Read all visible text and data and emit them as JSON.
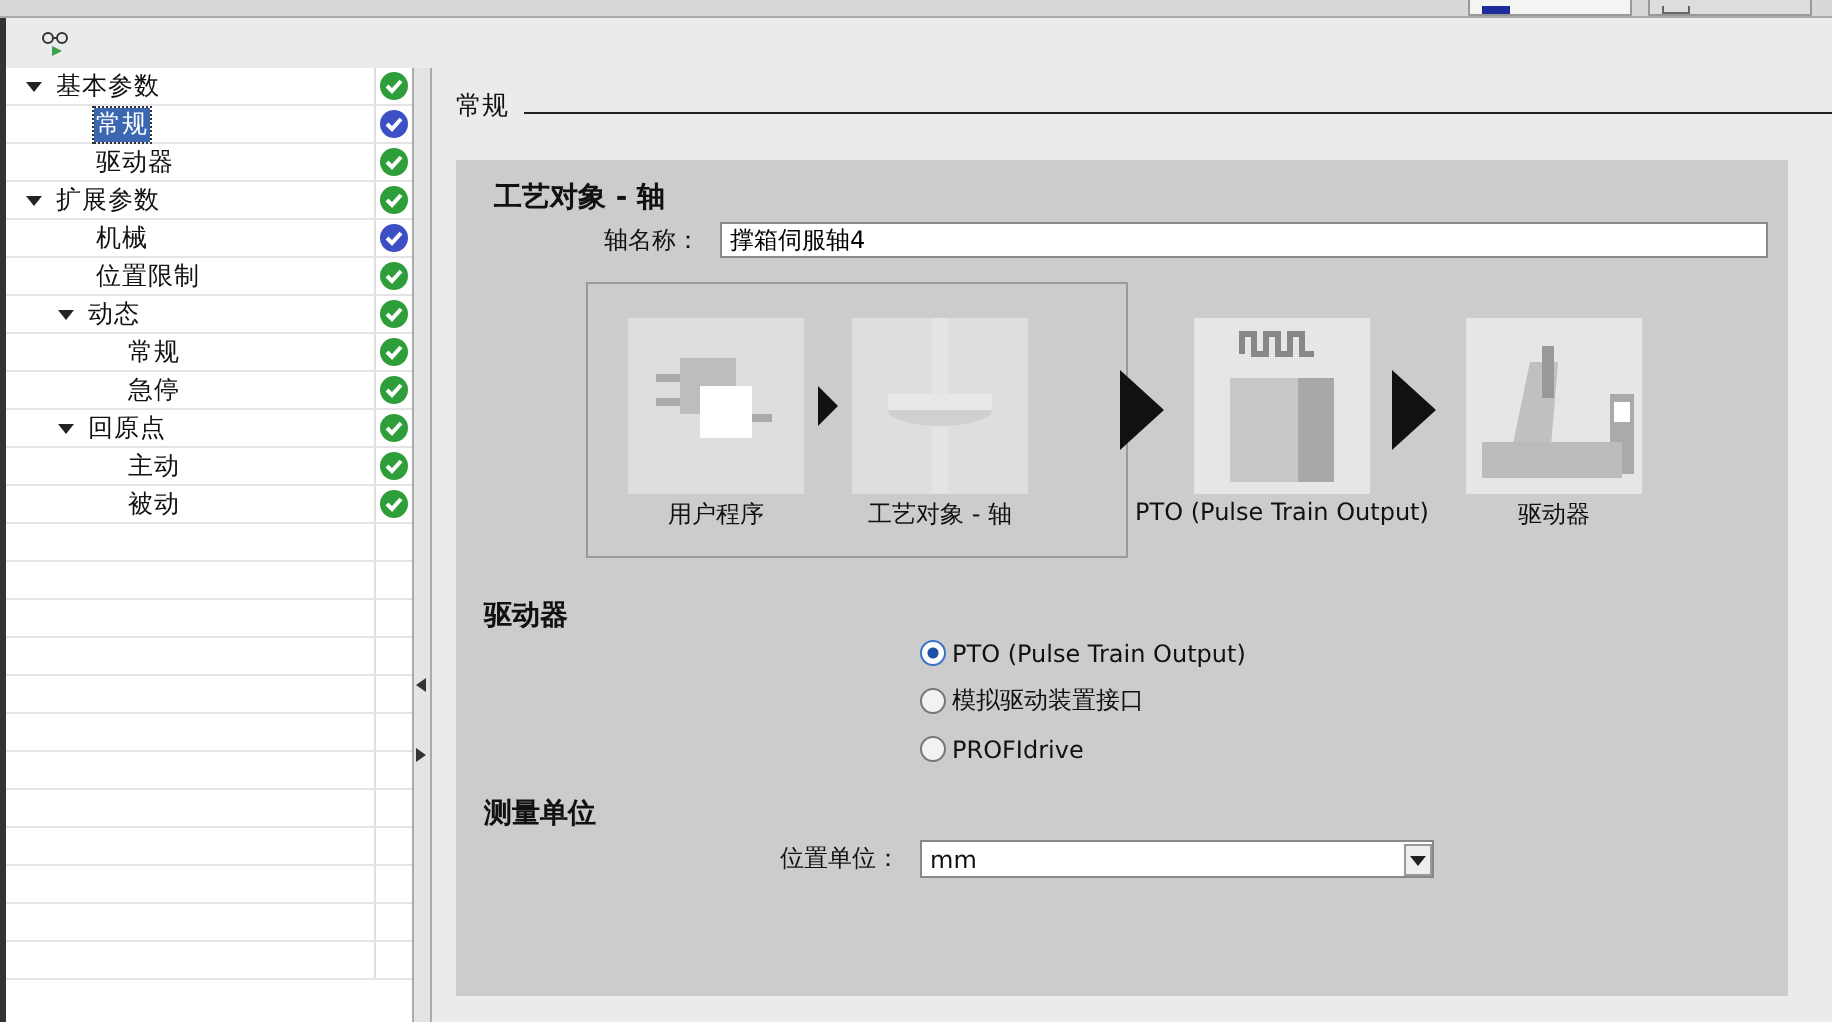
{
  "tree": [
    {
      "label": "基本参数",
      "expanded": true,
      "selected": false,
      "color": "#2e9e3a",
      "children": [
        {
          "label": "常规",
          "selected": true,
          "color": "#3d4fc4"
        },
        {
          "label": "驱动器",
          "selected": false,
          "color": "#2e9e3a"
        }
      ]
    },
    {
      "label": "扩展参数",
      "expanded": true,
      "selected": false,
      "color": "#2e9e3a",
      "children": [
        {
          "label": "机械",
          "selected": false,
          "color": "#3d4fc4"
        },
        {
          "label": "位置限制",
          "selected": false,
          "color": "#2e9e3a"
        },
        {
          "label": "动态",
          "expanded": true,
          "selected": false,
          "color": "#2e9e3a",
          "children": [
            {
              "label": "常规",
              "selected": false,
              "color": "#2e9e3a"
            },
            {
              "label": "急停",
              "selected": false,
              "color": "#2e9e3a"
            }
          ]
        },
        {
          "label": "回原点",
          "expanded": true,
          "selected": false,
          "color": "#2e9e3a",
          "children": [
            {
              "label": "主动",
              "selected": false,
              "color": "#2e9e3a"
            },
            {
              "label": "被动",
              "selected": false,
              "color": "#2e9e3a"
            }
          ]
        }
      ]
    }
  ],
  "section_title": "常规",
  "panel": {
    "title": "工艺对象 - 轴",
    "axis_name": {
      "label": "轴名称：",
      "value": "撑箱伺服轴4"
    },
    "flow": [
      {
        "kind": "program",
        "label": "用户程序",
        "framed": true
      },
      {
        "kind": "axis",
        "label": "工艺对象 - 轴",
        "framed": true
      },
      {
        "kind": "pto",
        "label": "PTO (Pulse Train Output)",
        "framed": false
      },
      {
        "kind": "drive",
        "label": "驱动器",
        "framed": false
      }
    ],
    "drive": {
      "title": "驱动器",
      "options": [
        {
          "label": "PTO (Pulse Train Output)",
          "selected": true
        },
        {
          "label": "模拟驱动装置接口",
          "selected": false
        },
        {
          "label": "PROFIdrive",
          "selected": false
        }
      ]
    },
    "units": {
      "title": "测量单位",
      "label": "位置单位：",
      "value": "mm"
    }
  }
}
